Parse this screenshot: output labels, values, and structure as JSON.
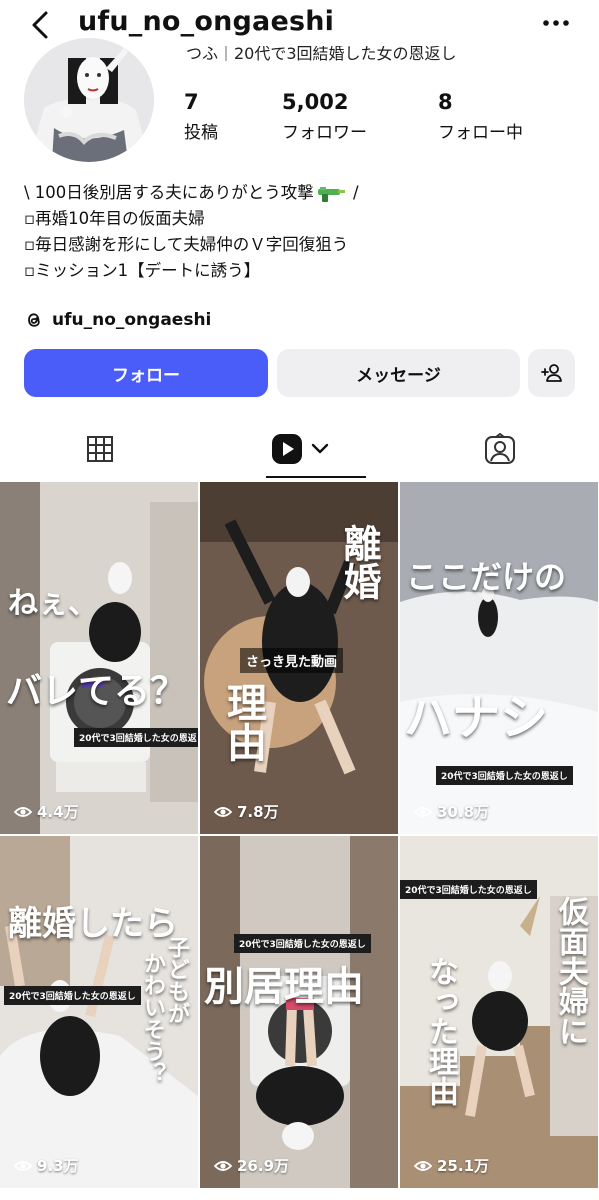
{
  "header": {
    "username": "ufu_no_ongaeshi"
  },
  "profile": {
    "full_name": "つふ｜20代で3回結婚した女の恩返し",
    "stats": [
      {
        "value": "7",
        "label": "投稿"
      },
      {
        "value": "5,002",
        "label": "フォロワー"
      },
      {
        "value": "8",
        "label": "フォロー中"
      }
    ],
    "bio": {
      "line1_a": "\\ 100日後別居する夫にありがとう攻撃",
      "line1_b": " /",
      "line2": "▫︎再婚10年目の仮面夫婦",
      "line3": "▫︎毎日感謝を形にして夫婦仲のＶ字回復狙う",
      "line4": "▫︎ミッション1【デートに誘う】"
    },
    "threads_handle": "ufu_no_ongaeshi"
  },
  "actions": {
    "follow": "フォロー",
    "message": "メッセージ"
  },
  "tabs": [
    {
      "name": "grid",
      "icon": "grid-icon"
    },
    {
      "name": "reels",
      "icon": "reels-icon",
      "active": true
    },
    {
      "name": "tagged",
      "icon": "tagged-user-icon"
    }
  ],
  "reels": [
    {
      "views": "4.4万",
      "overlay": [
        "ねぇ、",
        "バレてる？"
      ],
      "tag": "20代で3回結婚した女の恩返し"
    },
    {
      "views": "7.8万",
      "overlay": [
        "離婚",
        "理由"
      ],
      "caption": "さっき見た動画"
    },
    {
      "views": "30.8万",
      "overlay": [
        "ここだけの",
        "ハナシ"
      ],
      "tag": "20代で3回結婚した女の恩返し"
    },
    {
      "views": "9.3万",
      "overlay": [
        "離婚したら",
        "子どもが",
        "かわいそう？"
      ],
      "tag": "20代で3回結婚した女の恩返し"
    },
    {
      "views": "26.9万",
      "overlay": [
        "別居理由"
      ],
      "tag": "20代で3回結婚した女の恩返し"
    },
    {
      "views": "25.1万",
      "overlay": [
        "仮面夫婦に",
        "なった理由"
      ],
      "tag": "20代で3回結婚した女の恩返し"
    }
  ],
  "colors": {
    "accent": "#4a5df9",
    "button_bg": "#efeff2"
  }
}
